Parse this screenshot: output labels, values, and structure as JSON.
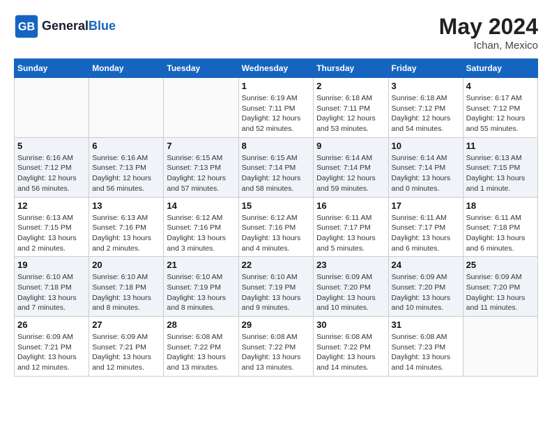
{
  "header": {
    "logo_general": "General",
    "logo_blue": "Blue",
    "month_year": "May 2024",
    "location": "Ichan, Mexico"
  },
  "weekdays": [
    "Sunday",
    "Monday",
    "Tuesday",
    "Wednesday",
    "Thursday",
    "Friday",
    "Saturday"
  ],
  "weeks": [
    [
      {
        "day": "",
        "info": ""
      },
      {
        "day": "",
        "info": ""
      },
      {
        "day": "",
        "info": ""
      },
      {
        "day": "1",
        "info": "Sunrise: 6:19 AM\nSunset: 7:11 PM\nDaylight: 12 hours and 52 minutes."
      },
      {
        "day": "2",
        "info": "Sunrise: 6:18 AM\nSunset: 7:11 PM\nDaylight: 12 hours and 53 minutes."
      },
      {
        "day": "3",
        "info": "Sunrise: 6:18 AM\nSunset: 7:12 PM\nDaylight: 12 hours and 54 minutes."
      },
      {
        "day": "4",
        "info": "Sunrise: 6:17 AM\nSunset: 7:12 PM\nDaylight: 12 hours and 55 minutes."
      }
    ],
    [
      {
        "day": "5",
        "info": "Sunrise: 6:16 AM\nSunset: 7:12 PM\nDaylight: 12 hours and 56 minutes."
      },
      {
        "day": "6",
        "info": "Sunrise: 6:16 AM\nSunset: 7:13 PM\nDaylight: 12 hours and 56 minutes."
      },
      {
        "day": "7",
        "info": "Sunrise: 6:15 AM\nSunset: 7:13 PM\nDaylight: 12 hours and 57 minutes."
      },
      {
        "day": "8",
        "info": "Sunrise: 6:15 AM\nSunset: 7:14 PM\nDaylight: 12 hours and 58 minutes."
      },
      {
        "day": "9",
        "info": "Sunrise: 6:14 AM\nSunset: 7:14 PM\nDaylight: 12 hours and 59 minutes."
      },
      {
        "day": "10",
        "info": "Sunrise: 6:14 AM\nSunset: 7:14 PM\nDaylight: 13 hours and 0 minutes."
      },
      {
        "day": "11",
        "info": "Sunrise: 6:13 AM\nSunset: 7:15 PM\nDaylight: 13 hours and 1 minute."
      }
    ],
    [
      {
        "day": "12",
        "info": "Sunrise: 6:13 AM\nSunset: 7:15 PM\nDaylight: 13 hours and 2 minutes."
      },
      {
        "day": "13",
        "info": "Sunrise: 6:13 AM\nSunset: 7:16 PM\nDaylight: 13 hours and 2 minutes."
      },
      {
        "day": "14",
        "info": "Sunrise: 6:12 AM\nSunset: 7:16 PM\nDaylight: 13 hours and 3 minutes."
      },
      {
        "day": "15",
        "info": "Sunrise: 6:12 AM\nSunset: 7:16 PM\nDaylight: 13 hours and 4 minutes."
      },
      {
        "day": "16",
        "info": "Sunrise: 6:11 AM\nSunset: 7:17 PM\nDaylight: 13 hours and 5 minutes."
      },
      {
        "day": "17",
        "info": "Sunrise: 6:11 AM\nSunset: 7:17 PM\nDaylight: 13 hours and 6 minutes."
      },
      {
        "day": "18",
        "info": "Sunrise: 6:11 AM\nSunset: 7:18 PM\nDaylight: 13 hours and 6 minutes."
      }
    ],
    [
      {
        "day": "19",
        "info": "Sunrise: 6:10 AM\nSunset: 7:18 PM\nDaylight: 13 hours and 7 minutes."
      },
      {
        "day": "20",
        "info": "Sunrise: 6:10 AM\nSunset: 7:18 PM\nDaylight: 13 hours and 8 minutes."
      },
      {
        "day": "21",
        "info": "Sunrise: 6:10 AM\nSunset: 7:19 PM\nDaylight: 13 hours and 8 minutes."
      },
      {
        "day": "22",
        "info": "Sunrise: 6:10 AM\nSunset: 7:19 PM\nDaylight: 13 hours and 9 minutes."
      },
      {
        "day": "23",
        "info": "Sunrise: 6:09 AM\nSunset: 7:20 PM\nDaylight: 13 hours and 10 minutes."
      },
      {
        "day": "24",
        "info": "Sunrise: 6:09 AM\nSunset: 7:20 PM\nDaylight: 13 hours and 10 minutes."
      },
      {
        "day": "25",
        "info": "Sunrise: 6:09 AM\nSunset: 7:20 PM\nDaylight: 13 hours and 11 minutes."
      }
    ],
    [
      {
        "day": "26",
        "info": "Sunrise: 6:09 AM\nSunset: 7:21 PM\nDaylight: 13 hours and 12 minutes."
      },
      {
        "day": "27",
        "info": "Sunrise: 6:09 AM\nSunset: 7:21 PM\nDaylight: 13 hours and 12 minutes."
      },
      {
        "day": "28",
        "info": "Sunrise: 6:08 AM\nSunset: 7:22 PM\nDaylight: 13 hours and 13 minutes."
      },
      {
        "day": "29",
        "info": "Sunrise: 6:08 AM\nSunset: 7:22 PM\nDaylight: 13 hours and 13 minutes."
      },
      {
        "day": "30",
        "info": "Sunrise: 6:08 AM\nSunset: 7:22 PM\nDaylight: 13 hours and 14 minutes."
      },
      {
        "day": "31",
        "info": "Sunrise: 6:08 AM\nSunset: 7:23 PM\nDaylight: 13 hours and 14 minutes."
      },
      {
        "day": "",
        "info": ""
      }
    ]
  ]
}
